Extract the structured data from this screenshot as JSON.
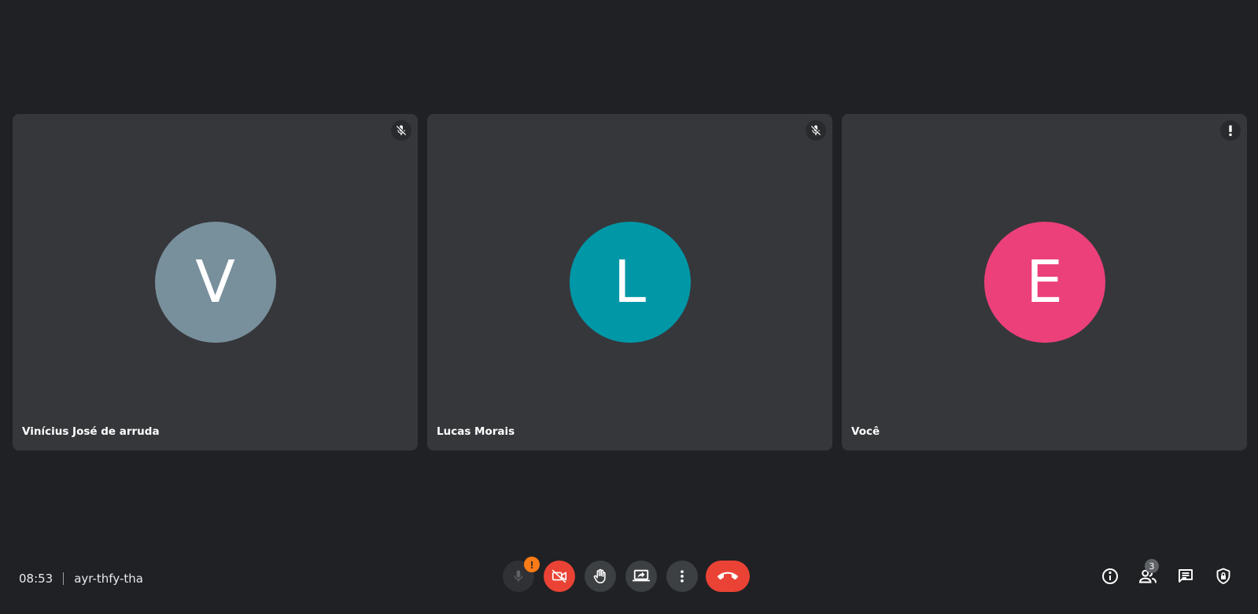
{
  "participants": [
    {
      "initial": "V",
      "name": "Vinícius José de arruda",
      "avatar_color": "#78909c",
      "status_icon": "mic-off-icon"
    },
    {
      "initial": "L",
      "name": "Lucas Morais",
      "avatar_color": "#0097a7",
      "status_icon": "mic-off-icon"
    },
    {
      "initial": "E",
      "name": "Você",
      "avatar_color": "#ec407a",
      "status_icon": "alert-icon"
    }
  ],
  "meeting": {
    "time": "08:53",
    "code": "ayr-thfy-tha"
  },
  "controls": {
    "mic_warning": "!",
    "mic_icon": "mic-icon",
    "camera_icon": "camera-off-icon",
    "hand_icon": "raise-hand-icon",
    "present_icon": "present-screen-icon",
    "more_icon": "more-options-icon",
    "hangup_icon": "hang-up-icon"
  },
  "right_panel": {
    "participant_count": "3",
    "icons": [
      "info-icon",
      "people-icon",
      "chat-icon",
      "host-controls-icon"
    ]
  },
  "colors": {
    "background": "#202124",
    "tile": "#36373b",
    "danger": "#ea4335",
    "warning": "#fa7b17"
  }
}
